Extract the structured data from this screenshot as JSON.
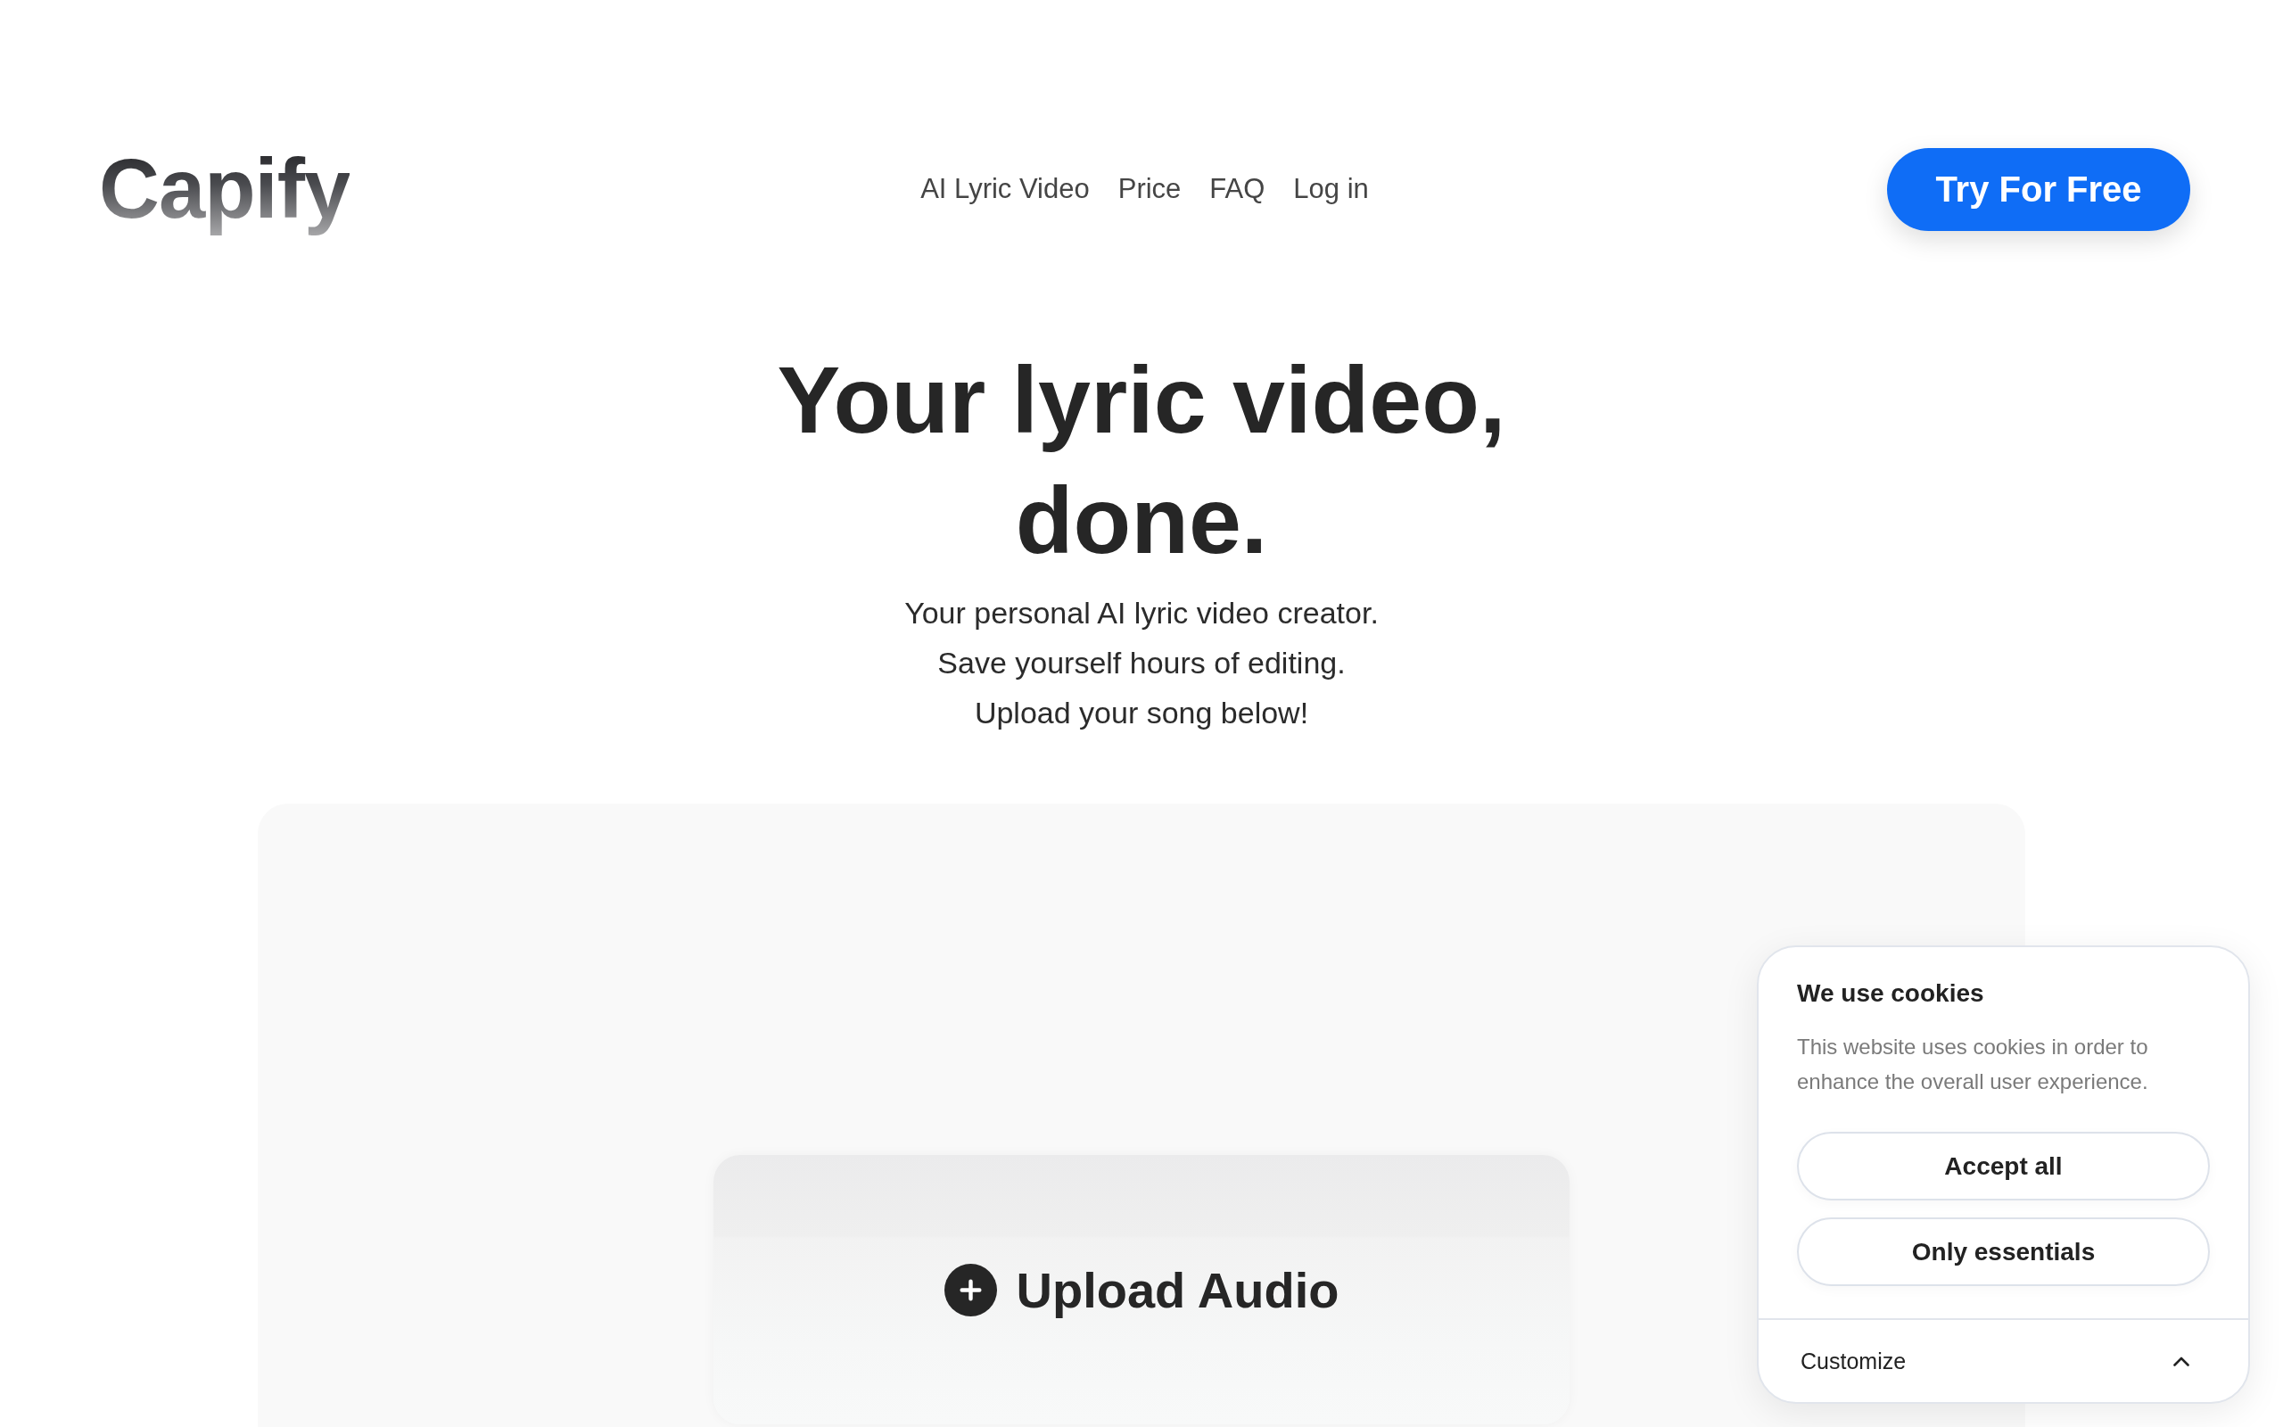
{
  "header": {
    "logo": "Capify",
    "nav_links": [
      "AI Lyric Video",
      "Price",
      "FAQ",
      "Log in"
    ],
    "cta_button": "Try For Free"
  },
  "hero": {
    "headline": "Your lyric video, done.",
    "subtitle_lines": [
      "Your personal AI lyric video creator.",
      "Save yourself hours of editing.",
      "Upload your song below!"
    ]
  },
  "upload_panel": {
    "upload_button": "Upload Audio"
  },
  "cookie_banner": {
    "title": "We use cookies",
    "description": "This website uses cookies in order to enhance the overall user experience.",
    "buttons": [
      "Accept all",
      "Only essentials"
    ],
    "customize": "Customize"
  }
}
